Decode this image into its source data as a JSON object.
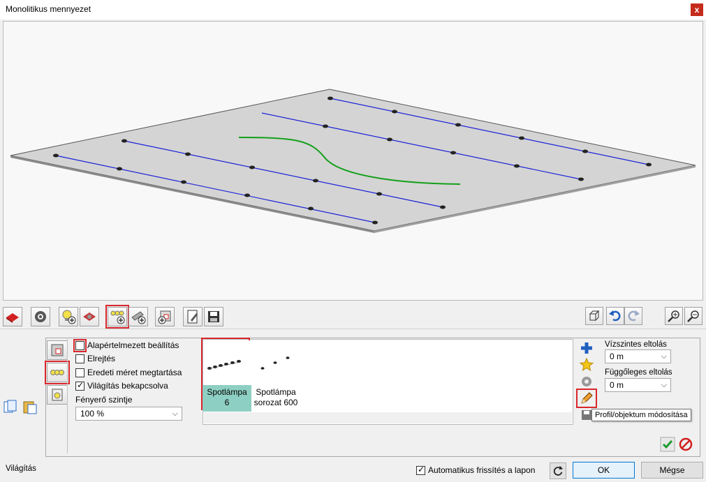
{
  "window": {
    "title": "Monolitikus mennyezet",
    "close_label": "x"
  },
  "options": {
    "default_setting": {
      "label": "Alapértelmezett beállítás",
      "checked": false
    },
    "hide": {
      "label": "Elrejtés",
      "checked": false
    },
    "keep_size": {
      "label": "Eredeti méret megtartása",
      "checked": false
    },
    "lighting_on": {
      "label": "Világítás bekapcsolva",
      "checked": true
    },
    "brightness_label": "Fényerő szintje",
    "brightness_value": "100 %"
  },
  "gallery": {
    "items": [
      {
        "line1": "Spotlámpa",
        "line2": "6",
        "selected": true
      },
      {
        "line1": "Spotlámpa",
        "line2": "sorozat 600",
        "selected": false
      }
    ]
  },
  "offsets": {
    "horizontal_label": "Vízszintes eltolás",
    "horizontal_value": "0 m",
    "vertical_label": "Függőleges eltolás",
    "vertical_value": "0 m"
  },
  "tooltip": "Profil/objektum módosítása",
  "footer": {
    "section_label": "Világítás",
    "auto_refresh_label": "Automatikus frissítés a lapon",
    "auto_refresh_checked": true,
    "ok_label": "OK",
    "cancel_label": "Mégse"
  },
  "colors": {
    "highlight": "#d9262c",
    "selection": "#8ecfc3",
    "blue_line": "#1a22d8",
    "green_curve": "#14a01a"
  }
}
